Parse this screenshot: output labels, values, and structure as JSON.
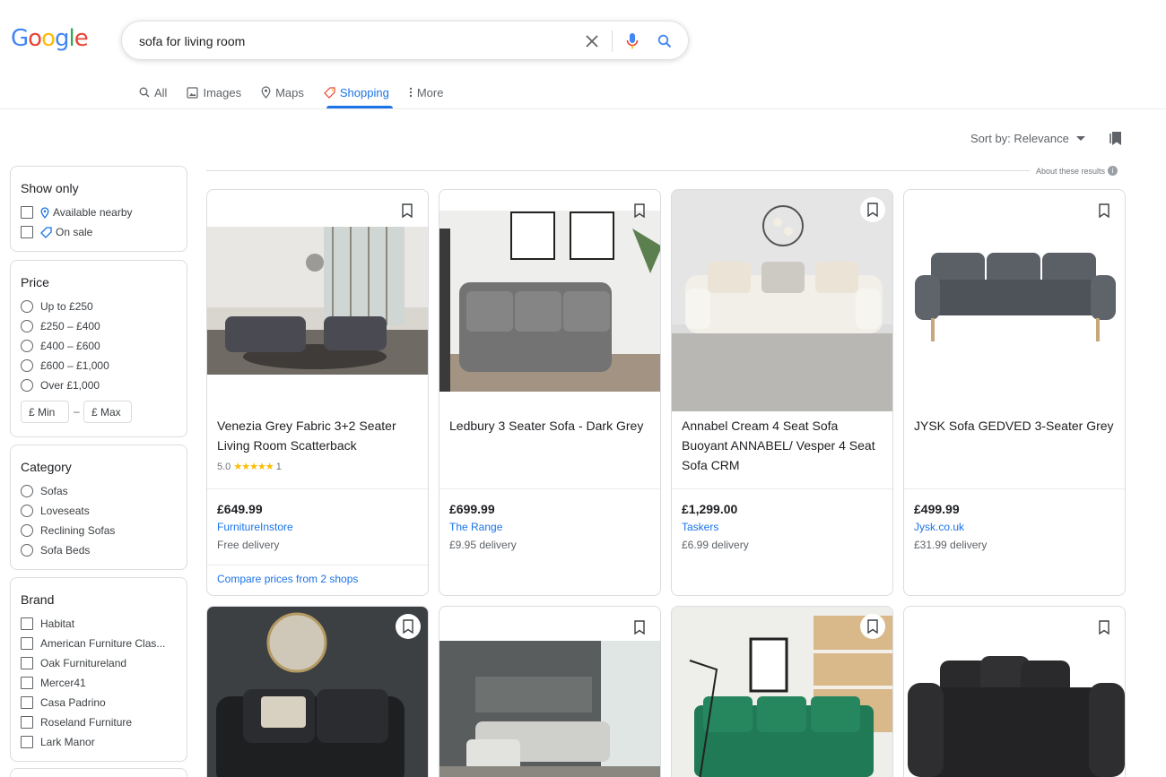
{
  "search": {
    "query": "sofa for living room"
  },
  "logo": "Google",
  "tabs": [
    {
      "label": "All"
    },
    {
      "label": "Images"
    },
    {
      "label": "Maps"
    },
    {
      "label": "Shopping"
    },
    {
      "label": "More"
    }
  ],
  "sort": {
    "label": "Sort by: Relevance"
  },
  "about": "About these results",
  "filters": {
    "show_only": {
      "title": "Show only",
      "items": [
        "Available nearby",
        "On sale"
      ]
    },
    "price": {
      "title": "Price",
      "items": [
        "Up to £250",
        "£250 – £400",
        "£400 – £600",
        "£600 – £1,000",
        "Over £1,000"
      ],
      "min_placeholder": "£ Min",
      "dash": "–",
      "max_placeholder": "£ Max"
    },
    "category": {
      "title": "Category",
      "items": [
        "Sofas",
        "Loveseats",
        "Reclining Sofas",
        "Sofa Beds"
      ]
    },
    "brand": {
      "title": "Brand",
      "items": [
        "Habitat",
        "American Furniture Clas...",
        "Oak Furnitureland",
        "Mercer41",
        "Casa Padrino",
        "Roseland Furniture",
        "Lark Manor"
      ]
    }
  },
  "products": [
    {
      "title": "Venezia Grey Fabric 3+2 Seater Living Room Scatterback",
      "rating": "5.0",
      "stars": "★★★★★",
      "reviews": "1",
      "price": "£649.99",
      "seller": "FurnitureInstore",
      "delivery": "Free delivery",
      "compare": "Compare prices from 2 shops"
    },
    {
      "title": "Ledbury 3 Seater Sofa - Dark Grey",
      "price": "£699.99",
      "seller": "The Range",
      "delivery": "£9.95 delivery"
    },
    {
      "title": "Annabel Cream 4 Seat Sofa Buoyant ANNABEL/ Vesper 4 Seat Sofa CRM",
      "price": "£1,299.00",
      "seller": "Taskers",
      "delivery": "£6.99 delivery"
    },
    {
      "title": "JYSK Sofa GEDVED 3-Seater Grey",
      "price": "£499.99",
      "seller": "Jysk.co.uk",
      "delivery": "£31.99 delivery"
    }
  ]
}
